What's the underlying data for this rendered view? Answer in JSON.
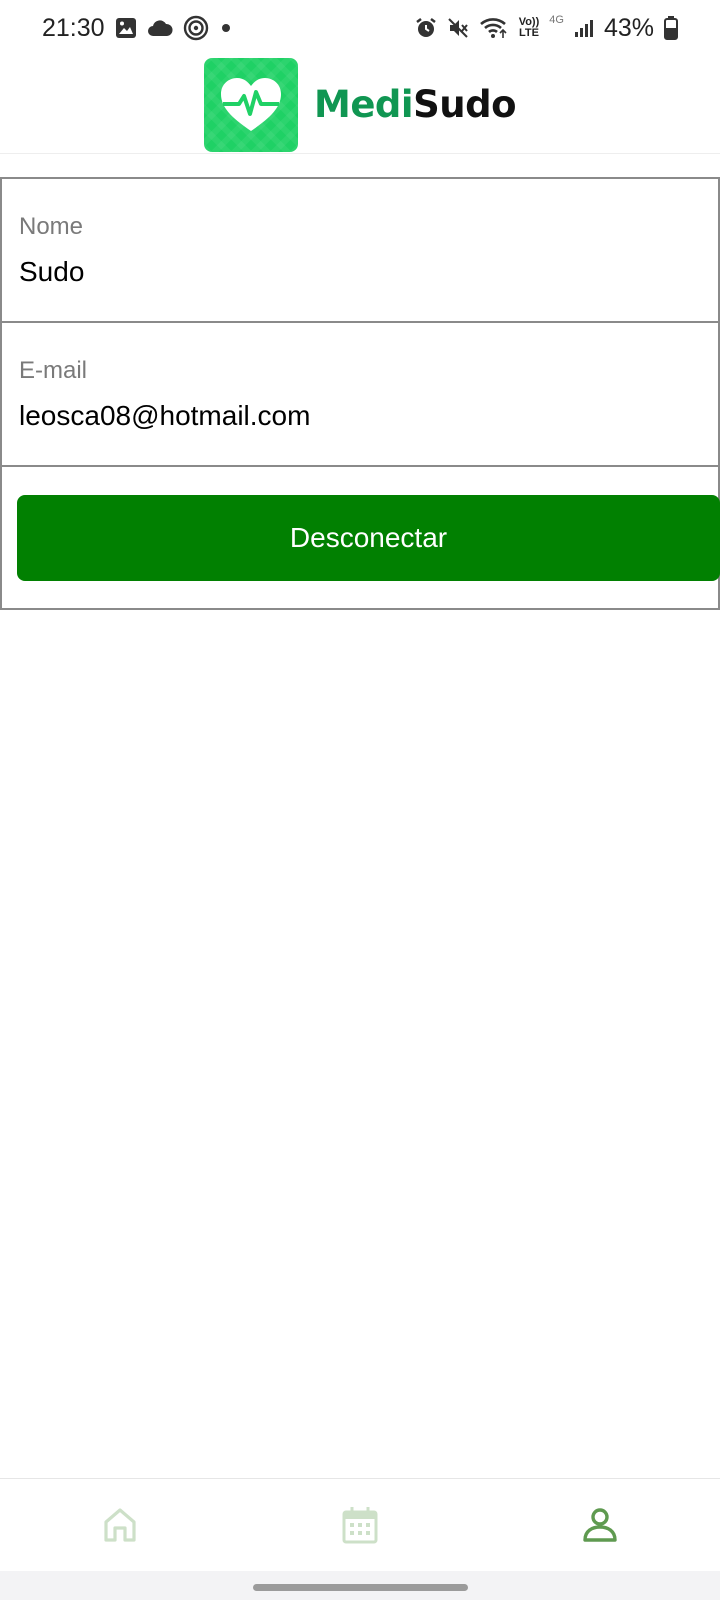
{
  "status_bar": {
    "time": "21:30",
    "volte_top": "Vo))",
    "volte_bottom": "LTE",
    "network": "4G",
    "battery": "43%",
    "icons": [
      "image-icon",
      "cloud-icon",
      "nfc-icon",
      "dot-icon",
      "alarm-icon",
      "mute-icon",
      "wifi-icon",
      "signal-icon",
      "battery-icon"
    ]
  },
  "header": {
    "logo_part1": "Medi",
    "logo_part2": "Sudo",
    "logo_color": "#1fd165"
  },
  "profile": {
    "name_label": "Nome",
    "name_value": "Sudo",
    "email_label": "E-mail",
    "email_value": "leosca08@hotmail.com",
    "logout_label": "Desconectar",
    "button_color": "#018001"
  },
  "bottom_nav": {
    "items": [
      {
        "icon": "home-icon",
        "active": false
      },
      {
        "icon": "calendar-icon",
        "active": false
      },
      {
        "icon": "profile-icon",
        "active": true
      }
    ],
    "inactive_color": "#cde0c8",
    "active_color": "#5f9a50"
  }
}
